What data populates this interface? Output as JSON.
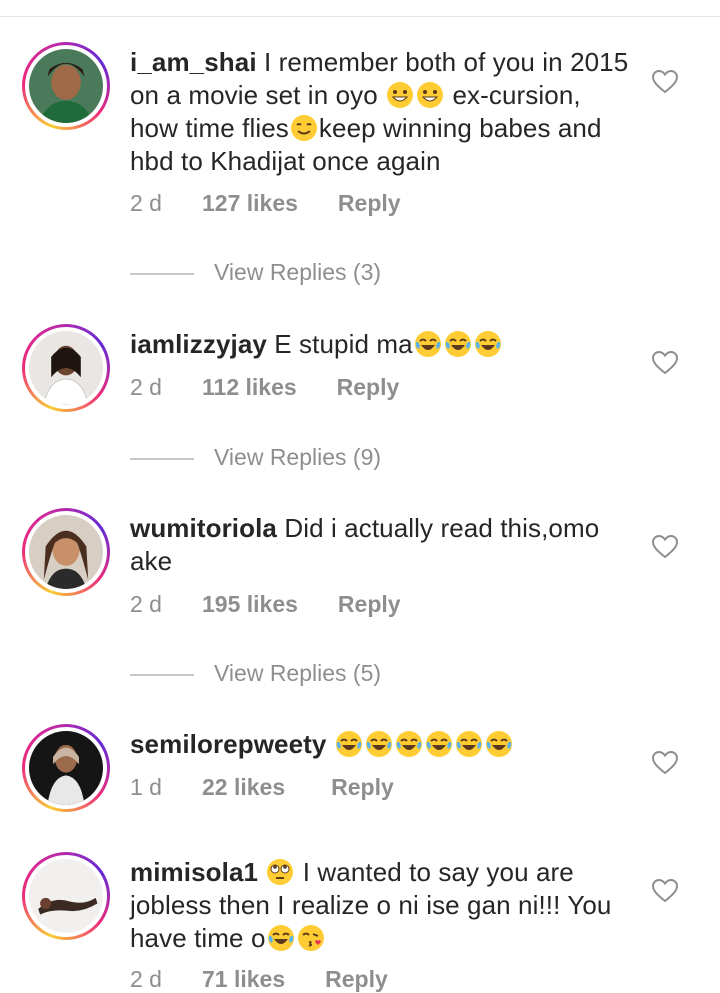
{
  "comments": [
    {
      "username": "i_am_shai",
      "text_parts": [
        "I remember both of you in 2015 on a movie set in oyo ",
        " ex-cursion, how time flies",
        "keep winning babes and hbd to Khadijat once again"
      ],
      "time": "2 d",
      "likes": "127 likes",
      "reply": "Reply",
      "view_replies": "View Replies (3)",
      "icon": "heart-outline"
    },
    {
      "username": "iamlizzyjay",
      "text": "E stupid ma",
      "time": "2 d",
      "likes": "112 likes",
      "reply": "Reply",
      "view_replies": "View Replies (9)",
      "icon": "heart-outline"
    },
    {
      "username": "wumitoriola",
      "text": "Did i actually read this,omo ake",
      "time": "2 d",
      "likes": "195 likes",
      "reply": "Reply",
      "view_replies": "View Replies (5)",
      "icon": "heart-outline"
    },
    {
      "username": "semilorepweety",
      "text": "",
      "time": "1 d",
      "likes": "22 likes",
      "reply": "Reply",
      "icon": "heart-outline"
    },
    {
      "username": "mimisola1",
      "text_parts": [
        "",
        " I wanted to say you are jobless then I realize o ni ise gan ni!!! You have time o"
      ],
      "time": "2 d",
      "likes": "71 likes",
      "reply": "Reply",
      "icon": "heart-outline"
    }
  ],
  "colors": {
    "text": "#262626",
    "meta": "#8e8e8e",
    "ring_start": "#f9ce34",
    "ring_mid": "#ee2a7b",
    "ring_end": "#6228d7"
  }
}
